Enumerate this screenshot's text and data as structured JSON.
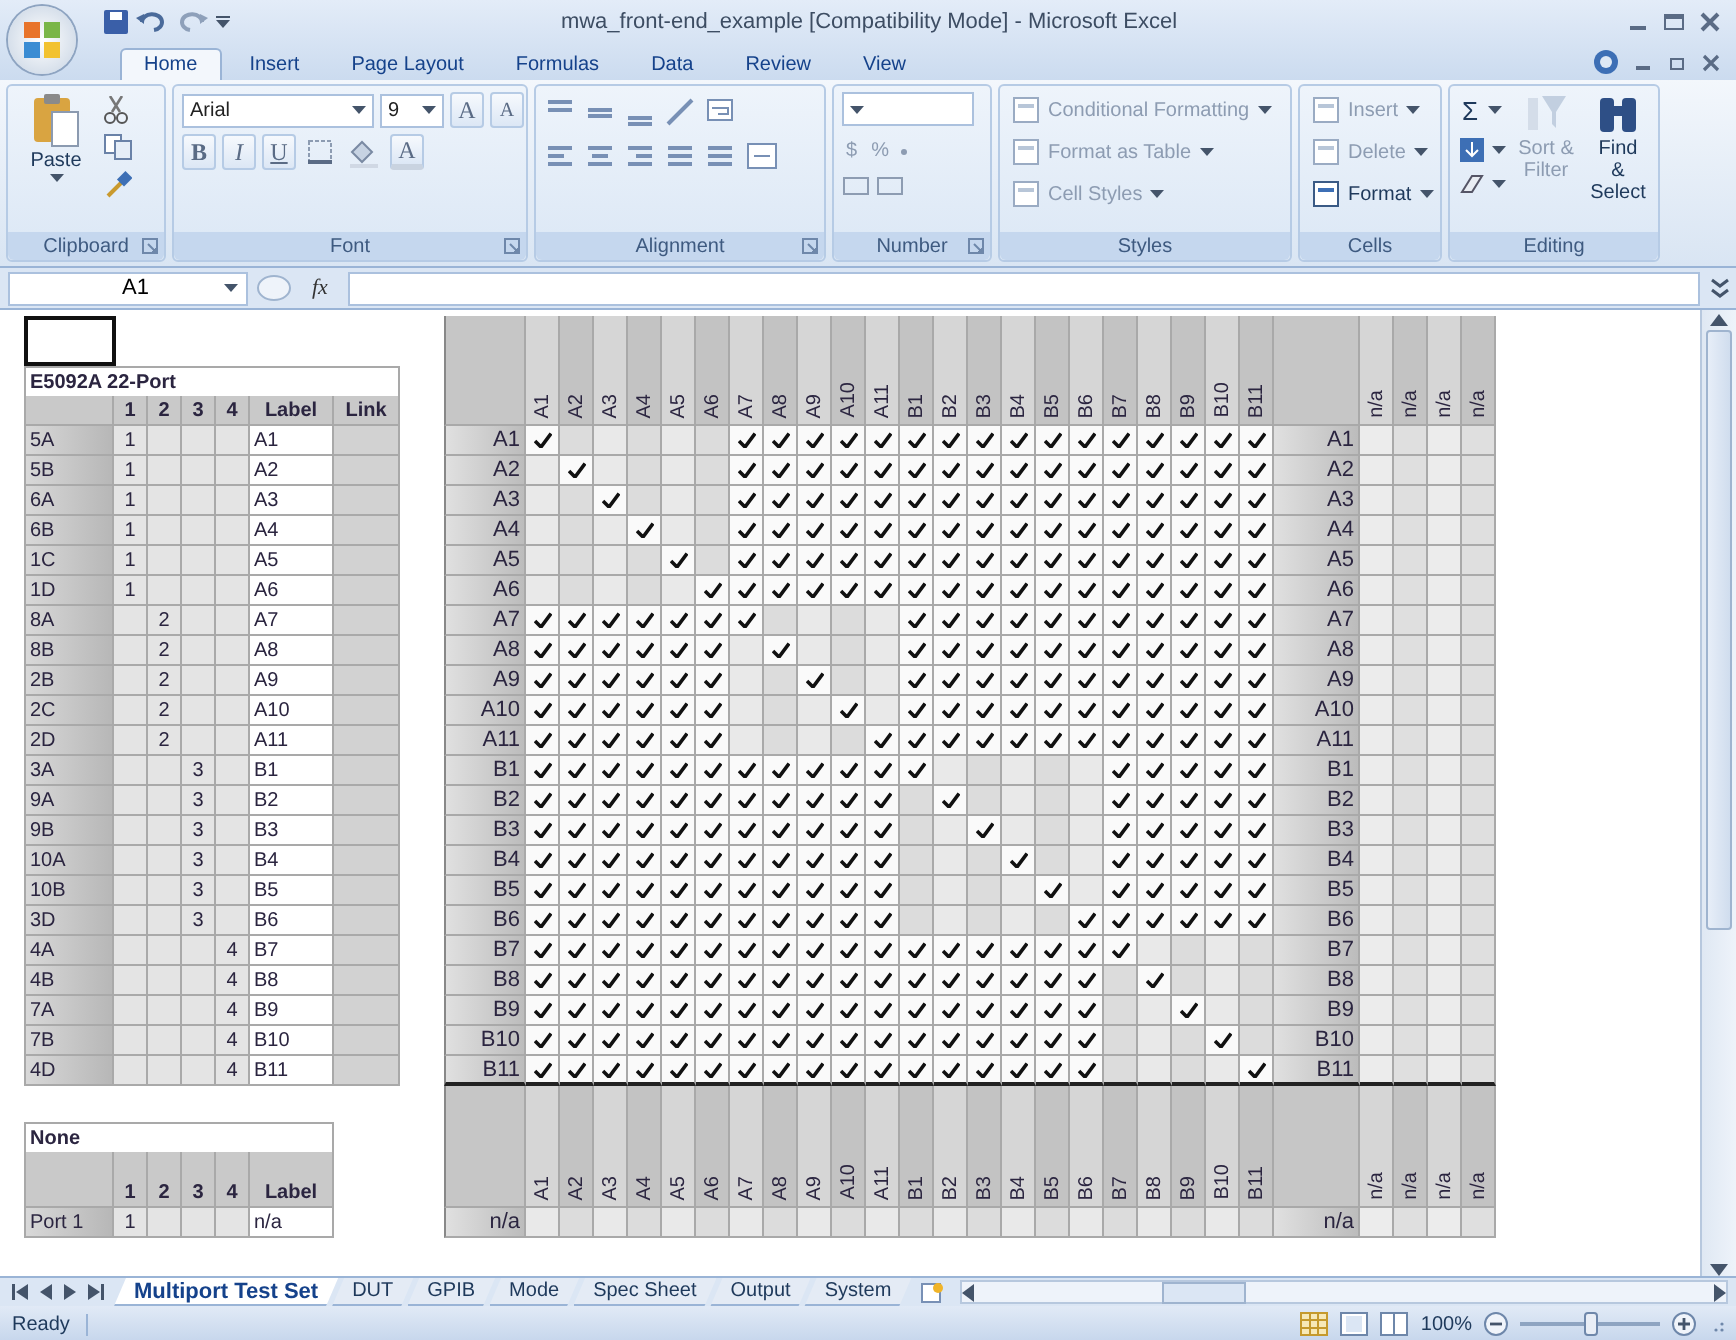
{
  "window": {
    "title": "mwa_front-end_example  [Compatibility Mode] - Microsoft Excel"
  },
  "ribbon_tabs": [
    {
      "label": "Home",
      "selected": true
    },
    {
      "label": "Insert",
      "selected": false
    },
    {
      "label": "Page Layout",
      "selected": false
    },
    {
      "label": "Formulas",
      "selected": false
    },
    {
      "label": "Data",
      "selected": false
    },
    {
      "label": "Review",
      "selected": false
    },
    {
      "label": "View",
      "selected": false
    }
  ],
  "ribbon_groups": [
    {
      "kind": "clipboard",
      "label": "Clipboard",
      "paste": "Paste"
    },
    {
      "kind": "font",
      "label": "Font",
      "font_name": "Arial",
      "font_size": "9",
      "size_buttons": [
        "A",
        "A"
      ],
      "style_buttons": [
        "B",
        "I",
        "U"
      ],
      "color_button": "A"
    },
    {
      "kind": "alignment",
      "label": "Alignment"
    },
    {
      "kind": "number",
      "label": "Number",
      "buttons": [
        "$",
        "%"
      ]
    },
    {
      "kind": "styles",
      "label": "Styles",
      "items": [
        {
          "label": "Conditional Formatting",
          "disabled": true
        },
        {
          "label": "Format as Table",
          "disabled": true
        },
        {
          "label": "Cell Styles",
          "disabled": true
        }
      ]
    },
    {
      "kind": "cells",
      "label": "Cells",
      "items": [
        {
          "label": "Insert",
          "disabled": true
        },
        {
          "label": "Delete",
          "disabled": true
        },
        {
          "label": "Format",
          "disabled": false
        }
      ]
    },
    {
      "kind": "editing",
      "label": "Editing",
      "sum": "Σ",
      "items": [
        {
          "label": "Sort & Filter",
          "disabled": true
        },
        {
          "label": "Find & Select",
          "disabled": false
        }
      ]
    }
  ],
  "formula_bar": {
    "name_box": "A1",
    "function_label": "fx"
  },
  "port_table": {
    "title": "E5092A 22-Port",
    "columns": [
      "1",
      "2",
      "3",
      "4",
      "Label",
      "Link"
    ],
    "rows": [
      {
        "name": "5A",
        "values": [
          {
            "kind": "filled",
            "text": "1"
          },
          {
            "kind": "blank"
          },
          {
            "kind": "blank"
          },
          {
            "kind": "blank"
          }
        ],
        "label": "A1"
      },
      {
        "name": "5B",
        "values": [
          {
            "kind": "filled",
            "text": "1"
          },
          {
            "kind": "blank"
          },
          {
            "kind": "blank"
          },
          {
            "kind": "blank"
          }
        ],
        "label": "A2"
      },
      {
        "name": "6A",
        "values": [
          {
            "kind": "filled",
            "text": "1"
          },
          {
            "kind": "blank"
          },
          {
            "kind": "blank"
          },
          {
            "kind": "blank"
          }
        ],
        "label": "A3"
      },
      {
        "name": "6B",
        "values": [
          {
            "kind": "filled",
            "text": "1"
          },
          {
            "kind": "blank"
          },
          {
            "kind": "blank"
          },
          {
            "kind": "blank"
          }
        ],
        "label": "A4"
      },
      {
        "name": "1C",
        "values": [
          {
            "kind": "filled",
            "text": "1"
          },
          {
            "kind": "blank"
          },
          {
            "kind": "blank"
          },
          {
            "kind": "blank"
          }
        ],
        "label": "A5"
      },
      {
        "name": "1D",
        "values": [
          {
            "kind": "filled",
            "text": "1"
          },
          {
            "kind": "blank"
          },
          {
            "kind": "blank"
          },
          {
            "kind": "blank"
          }
        ],
        "label": "A6"
      },
      {
        "name": "8A",
        "values": [
          {
            "kind": "blank"
          },
          {
            "kind": "filled",
            "text": "2"
          },
          {
            "kind": "blank"
          },
          {
            "kind": "blank"
          }
        ],
        "label": "A7"
      },
      {
        "name": "8B",
        "values": [
          {
            "kind": "blank"
          },
          {
            "kind": "filled",
            "text": "2"
          },
          {
            "kind": "blank"
          },
          {
            "kind": "blank"
          }
        ],
        "label": "A8"
      },
      {
        "name": "2B",
        "values": [
          {
            "kind": "blank"
          },
          {
            "kind": "filled",
            "text": "2"
          },
          {
            "kind": "blank"
          },
          {
            "kind": "blank"
          }
        ],
        "label": "A9"
      },
      {
        "name": "2C",
        "values": [
          {
            "kind": "blank"
          },
          {
            "kind": "filled",
            "text": "2"
          },
          {
            "kind": "blank"
          },
          {
            "kind": "blank"
          }
        ],
        "label": "A10"
      },
      {
        "name": "2D",
        "values": [
          {
            "kind": "blank"
          },
          {
            "kind": "filled",
            "text": "2"
          },
          {
            "kind": "blank"
          },
          {
            "kind": "blank"
          }
        ],
        "label": "A11"
      },
      {
        "name": "3A",
        "values": [
          {
            "kind": "blank"
          },
          {
            "kind": "blank"
          },
          {
            "kind": "filled",
            "text": "3"
          },
          {
            "kind": "blank"
          }
        ],
        "label": "B1"
      },
      {
        "name": "9A",
        "values": [
          {
            "kind": "blank"
          },
          {
            "kind": "blank"
          },
          {
            "kind": "filled",
            "text": "3"
          },
          {
            "kind": "blank"
          }
        ],
        "label": "B2"
      },
      {
        "name": "9B",
        "values": [
          {
            "kind": "blank"
          },
          {
            "kind": "blank"
          },
          {
            "kind": "filled",
            "text": "3"
          },
          {
            "kind": "blank"
          }
        ],
        "label": "B3"
      },
      {
        "name": "10A",
        "values": [
          {
            "kind": "blank"
          },
          {
            "kind": "blank"
          },
          {
            "kind": "filled",
            "text": "3"
          },
          {
            "kind": "blank"
          }
        ],
        "label": "B4"
      },
      {
        "name": "10B",
        "values": [
          {
            "kind": "blank"
          },
          {
            "kind": "blank"
          },
          {
            "kind": "filled",
            "text": "3"
          },
          {
            "kind": "blank"
          }
        ],
        "label": "B5"
      },
      {
        "name": "3D",
        "values": [
          {
            "kind": "blank"
          },
          {
            "kind": "blank"
          },
          {
            "kind": "filled",
            "text": "3"
          },
          {
            "kind": "blank"
          }
        ],
        "label": "B6"
      },
      {
        "name": "4A",
        "values": [
          {
            "kind": "blank"
          },
          {
            "kind": "blank"
          },
          {
            "kind": "blank"
          },
          {
            "kind": "filled",
            "text": "4"
          }
        ],
        "label": "B7"
      },
      {
        "name": "4B",
        "values": [
          {
            "kind": "blank"
          },
          {
            "kind": "blank"
          },
          {
            "kind": "blank"
          },
          {
            "kind": "filled",
            "text": "4"
          }
        ],
        "label": "B8"
      },
      {
        "name": "7A",
        "values": [
          {
            "kind": "blank"
          },
          {
            "kind": "blank"
          },
          {
            "kind": "blank"
          },
          {
            "kind": "filled",
            "text": "4"
          }
        ],
        "label": "B9"
      },
      {
        "name": "7B",
        "values": [
          {
            "kind": "blank"
          },
          {
            "kind": "blank"
          },
          {
            "kind": "blank"
          },
          {
            "kind": "filled",
            "text": "4"
          }
        ],
        "label": "B10"
      },
      {
        "name": "4D",
        "values": [
          {
            "kind": "blank"
          },
          {
            "kind": "blank"
          },
          {
            "kind": "blank"
          },
          {
            "kind": "filled",
            "text": "4"
          }
        ],
        "label": "B11"
      }
    ]
  },
  "none_table": {
    "title": "None",
    "columns": [
      "1",
      "2",
      "3",
      "4",
      "Label"
    ],
    "rows": [
      {
        "name": "Port 1",
        "values": [
          {
            "kind": "filled",
            "text": "1"
          },
          {
            "kind": "blank"
          },
          {
            "kind": "blank"
          },
          {
            "kind": "blank"
          }
        ],
        "label": "n/a"
      }
    ]
  },
  "matrix": {
    "columns": [
      "A1",
      "A2",
      "A3",
      "A4",
      "A5",
      "A6",
      "A7",
      "A8",
      "A9",
      "A10",
      "A11",
      "B1",
      "B2",
      "B3",
      "B4",
      "B5",
      "B6",
      "B7",
      "B8",
      "B9",
      "B10",
      "B11"
    ],
    "extra_columns": [
      "n/a",
      "n/a",
      "n/a",
      "n/a"
    ],
    "rows": [
      {
        "label": "A1",
        "side_label": "A1",
        "checks": [
          true,
          false,
          false,
          false,
          false,
          false,
          true,
          true,
          true,
          true,
          true,
          true,
          true,
          true,
          true,
          true,
          true,
          true,
          true,
          true,
          true,
          true
        ]
      },
      {
        "label": "A2",
        "side_label": "A2",
        "checks": [
          false,
          true,
          false,
          false,
          false,
          false,
          true,
          true,
          true,
          true,
          true,
          true,
          true,
          true,
          true,
          true,
          true,
          true,
          true,
          true,
          true,
          true
        ]
      },
      {
        "label": "A3",
        "side_label": "A3",
        "checks": [
          false,
          false,
          true,
          false,
          false,
          false,
          true,
          true,
          true,
          true,
          true,
          true,
          true,
          true,
          true,
          true,
          true,
          true,
          true,
          true,
          true,
          true
        ]
      },
      {
        "label": "A4",
        "side_label": "A4",
        "checks": [
          false,
          false,
          false,
          true,
          false,
          false,
          true,
          true,
          true,
          true,
          true,
          true,
          true,
          true,
          true,
          true,
          true,
          true,
          true,
          true,
          true,
          true
        ]
      },
      {
        "label": "A5",
        "side_label": "A5",
        "checks": [
          false,
          false,
          false,
          false,
          true,
          false,
          true,
          true,
          true,
          true,
          true,
          true,
          true,
          true,
          true,
          true,
          true,
          true,
          true,
          true,
          true,
          true
        ]
      },
      {
        "label": "A6",
        "side_label": "A6",
        "checks": [
          false,
          false,
          false,
          false,
          false,
          true,
          true,
          true,
          true,
          true,
          true,
          true,
          true,
          true,
          true,
          true,
          true,
          true,
          true,
          true,
          true,
          true
        ]
      },
      {
        "label": "A7",
        "side_label": "A7",
        "checks": [
          true,
          true,
          true,
          true,
          true,
          true,
          true,
          false,
          false,
          false,
          false,
          true,
          true,
          true,
          true,
          true,
          true,
          true,
          true,
          true,
          true,
          true
        ]
      },
      {
        "label": "A8",
        "side_label": "A8",
        "checks": [
          true,
          true,
          true,
          true,
          true,
          true,
          false,
          true,
          false,
          false,
          false,
          true,
          true,
          true,
          true,
          true,
          true,
          true,
          true,
          true,
          true,
          true
        ]
      },
      {
        "label": "A9",
        "side_label": "A9",
        "checks": [
          true,
          true,
          true,
          true,
          true,
          true,
          false,
          false,
          true,
          false,
          false,
          true,
          true,
          true,
          true,
          true,
          true,
          true,
          true,
          true,
          true,
          true
        ]
      },
      {
        "label": "A10",
        "side_label": "A10",
        "checks": [
          true,
          true,
          true,
          true,
          true,
          true,
          false,
          false,
          false,
          true,
          false,
          true,
          true,
          true,
          true,
          true,
          true,
          true,
          true,
          true,
          true,
          true
        ]
      },
      {
        "label": "A11",
        "side_label": "A11",
        "checks": [
          true,
          true,
          true,
          true,
          true,
          true,
          false,
          false,
          false,
          false,
          true,
          true,
          true,
          true,
          true,
          true,
          true,
          true,
          true,
          true,
          true,
          true
        ]
      },
      {
        "label": "B1",
        "side_label": "B1",
        "checks": [
          true,
          true,
          true,
          true,
          true,
          true,
          true,
          true,
          true,
          true,
          true,
          true,
          false,
          false,
          false,
          false,
          false,
          true,
          true,
          true,
          true,
          true
        ]
      },
      {
        "label": "B2",
        "side_label": "B2",
        "checks": [
          true,
          true,
          true,
          true,
          true,
          true,
          true,
          true,
          true,
          true,
          true,
          false,
          true,
          false,
          false,
          false,
          false,
          true,
          true,
          true,
          true,
          true
        ]
      },
      {
        "label": "B3",
        "side_label": "B3",
        "checks": [
          true,
          true,
          true,
          true,
          true,
          true,
          true,
          true,
          true,
          true,
          true,
          false,
          false,
          true,
          false,
          false,
          false,
          true,
          true,
          true,
          true,
          true
        ]
      },
      {
        "label": "B4",
        "side_label": "B4",
        "checks": [
          true,
          true,
          true,
          true,
          true,
          true,
          true,
          true,
          true,
          true,
          true,
          false,
          false,
          false,
          true,
          false,
          false,
          true,
          true,
          true,
          true,
          true
        ]
      },
      {
        "label": "B5",
        "side_label": "B5",
        "checks": [
          true,
          true,
          true,
          true,
          true,
          true,
          true,
          true,
          true,
          true,
          true,
          false,
          false,
          false,
          false,
          true,
          false,
          true,
          true,
          true,
          true,
          true
        ]
      },
      {
        "label": "B6",
        "side_label": "B6",
        "checks": [
          true,
          true,
          true,
          true,
          true,
          true,
          true,
          true,
          true,
          true,
          true,
          false,
          false,
          false,
          false,
          false,
          true,
          true,
          true,
          true,
          true,
          true
        ]
      },
      {
        "label": "B7",
        "side_label": "B7",
        "checks": [
          true,
          true,
          true,
          true,
          true,
          true,
          true,
          true,
          true,
          true,
          true,
          true,
          true,
          true,
          true,
          true,
          true,
          true,
          false,
          false,
          false,
          false
        ]
      },
      {
        "label": "B8",
        "side_label": "B8",
        "checks": [
          true,
          true,
          true,
          true,
          true,
          true,
          true,
          true,
          true,
          true,
          true,
          true,
          true,
          true,
          true,
          true,
          true,
          false,
          true,
          false,
          false,
          false
        ]
      },
      {
        "label": "B9",
        "side_label": "B9",
        "checks": [
          true,
          true,
          true,
          true,
          true,
          true,
          true,
          true,
          true,
          true,
          true,
          true,
          true,
          true,
          true,
          true,
          true,
          false,
          false,
          true,
          false,
          false
        ]
      },
      {
        "label": "B10",
        "side_label": "B10",
        "checks": [
          true,
          true,
          true,
          true,
          true,
          true,
          true,
          true,
          true,
          true,
          true,
          true,
          true,
          true,
          true,
          true,
          true,
          false,
          false,
          false,
          true,
          false
        ]
      },
      {
        "label": "B11",
        "side_label": "B11",
        "checks": [
          true,
          true,
          true,
          true,
          true,
          true,
          true,
          true,
          true,
          true,
          true,
          true,
          true,
          true,
          true,
          true,
          true,
          false,
          false,
          false,
          false,
          true
        ]
      }
    ]
  },
  "bottom_matrix": {
    "columns": [
      "A1",
      "A2",
      "A3",
      "A4",
      "A5",
      "A6",
      "A7",
      "A8",
      "A9",
      "A10",
      "A11",
      "B1",
      "B2",
      "B3",
      "B4",
      "B5",
      "B6",
      "B7",
      "B8",
      "B9",
      "B10",
      "B11"
    ],
    "extra_columns": [
      "n/a",
      "n/a",
      "n/a",
      "n/a"
    ],
    "rows": [
      {
        "label": "n/a",
        "side_label": "n/a"
      }
    ]
  },
  "sheet_tabs": [
    {
      "label": "Multiport Test Set",
      "selected": true
    },
    {
      "label": "DUT",
      "selected": false
    },
    {
      "label": "GPIB",
      "selected": false
    },
    {
      "label": "Mode",
      "selected": false
    },
    {
      "label": "Spec Sheet",
      "selected": false
    },
    {
      "label": "Output",
      "selected": false
    },
    {
      "label": "System",
      "selected": false
    }
  ],
  "status_bar": {
    "status": "Ready",
    "zoom": "100%",
    "zoom_slider": {
      "level": 0.5
    }
  }
}
